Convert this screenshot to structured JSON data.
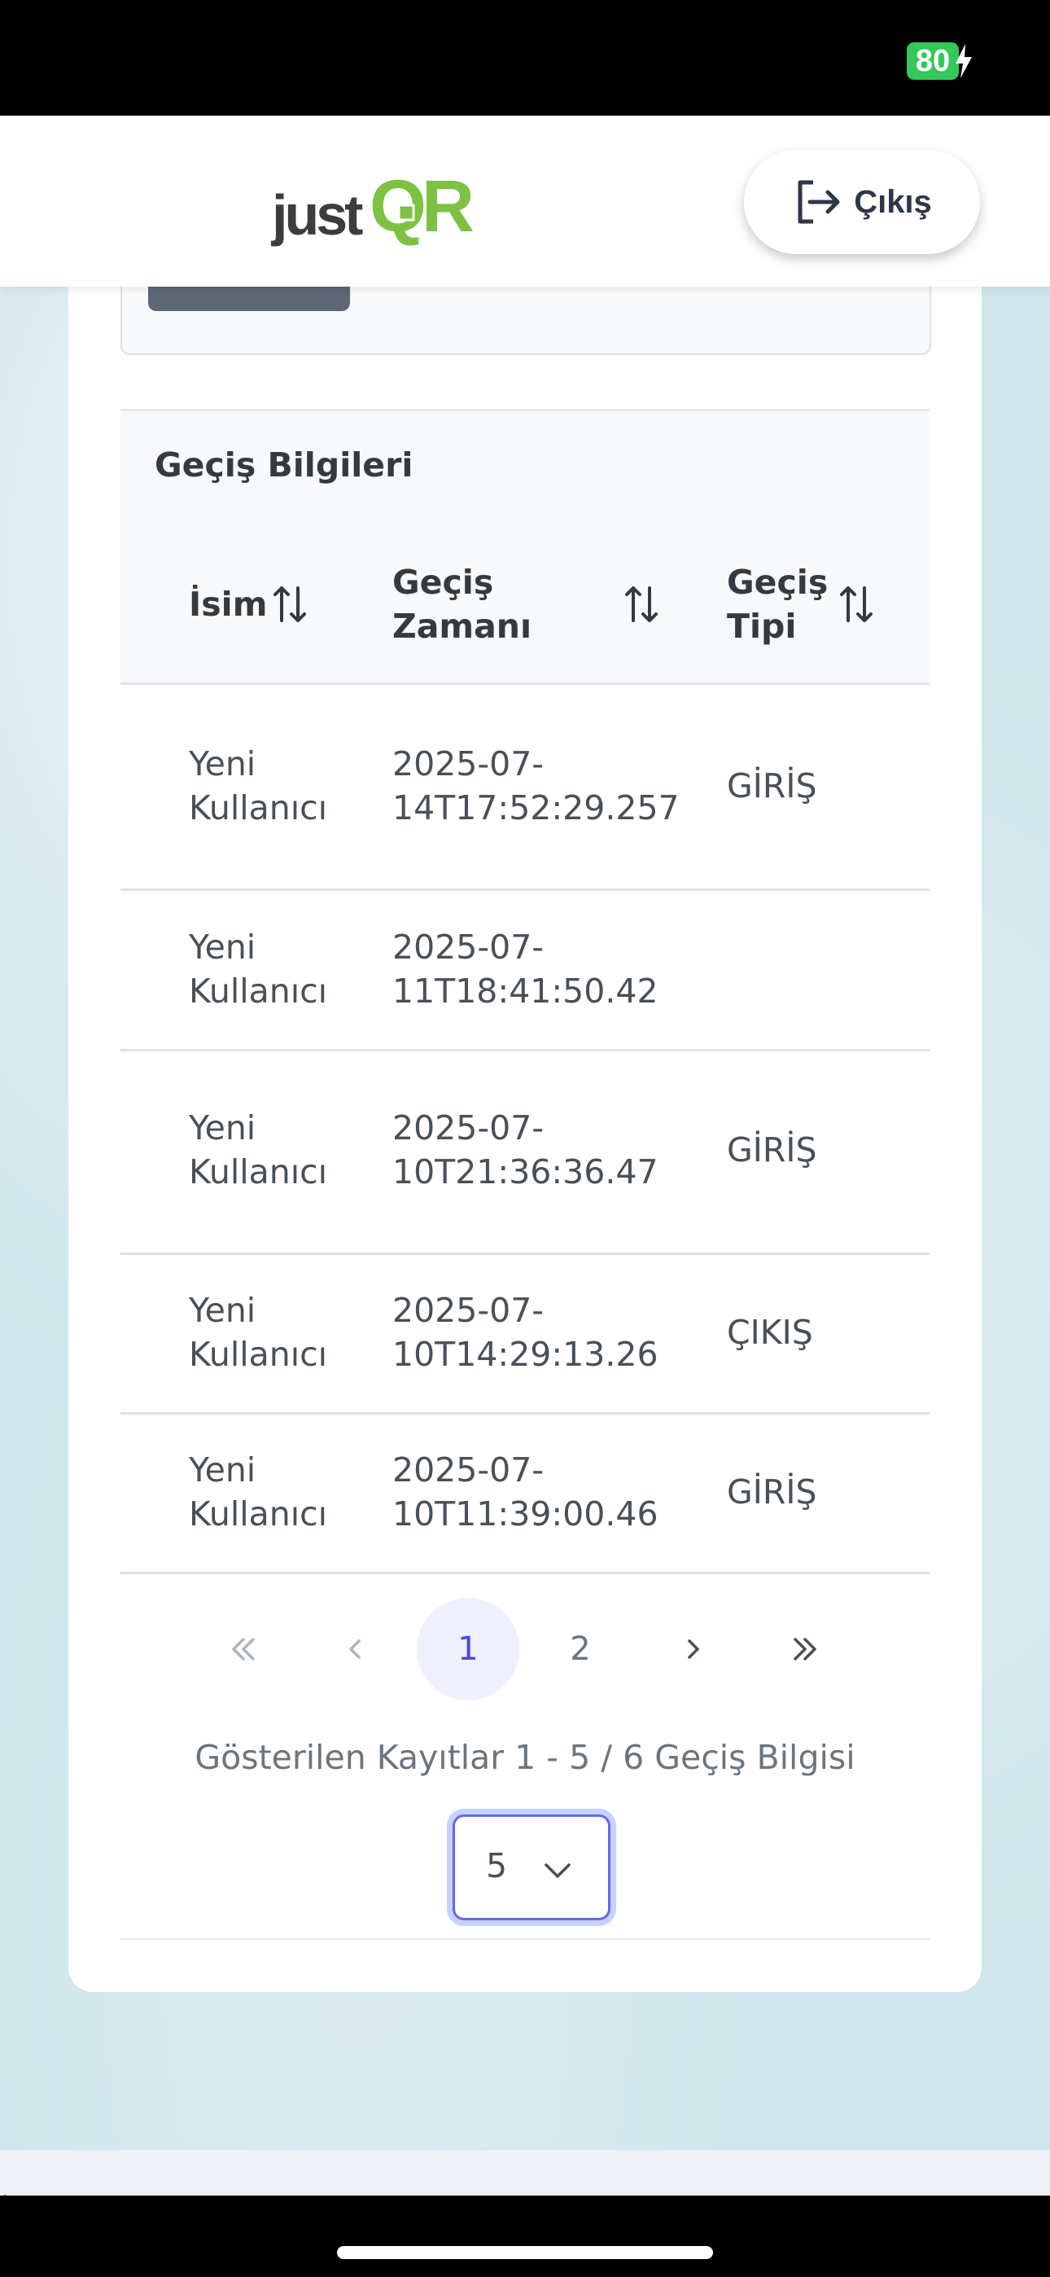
{
  "status_bar": {
    "battery": "80"
  },
  "header": {
    "logo_text": "justQR",
    "logout_label": "Çıkış"
  },
  "table": {
    "title": "Geçiş Bilgileri",
    "columns": [
      {
        "line1": "İsim",
        "line2": ""
      },
      {
        "line1": "Geçiş",
        "line2": "Zamanı"
      },
      {
        "line1": "Geçiş",
        "line2": "Tipi"
      }
    ],
    "rows": [
      {
        "name1": "Yeni",
        "name2": "Kullanıcı",
        "time1": "2025-07-",
        "time2": "14T17:52:29.257",
        "type": "GİRİŞ"
      },
      {
        "name1": "Yeni",
        "name2": "Kullanıcı",
        "time1": "2025-07-",
        "time2": "11T18:41:50.42",
        "type": ""
      },
      {
        "name1": "Yeni",
        "name2": "Kullanıcı",
        "time1": "2025-07-",
        "time2": "10T21:36:36.47",
        "type": "GİRİŞ"
      },
      {
        "name1": "Yeni",
        "name2": "Kullanıcı",
        "time1": "2025-07-",
        "time2": "10T14:29:13.26",
        "type": "ÇIKIŞ"
      },
      {
        "name1": "Yeni",
        "name2": "Kullanıcı",
        "time1": "2025-07-",
        "time2": "10T11:39:00.46",
        "type": "GİRİŞ"
      }
    ]
  },
  "pagination": {
    "pages": [
      "1",
      "2"
    ],
    "current_page": "1",
    "summary": "Gösterilen Kayıtlar 1 - 5 / 6 Geçiş Bilgisi",
    "page_size": "5"
  },
  "bottom_strip": {
    "mark": ","
  },
  "colors": {
    "accent": "#4f46e5",
    "battery": "#34c759",
    "logo_green": "#7dc242",
    "logo_dark": "#3d3d3d"
  }
}
